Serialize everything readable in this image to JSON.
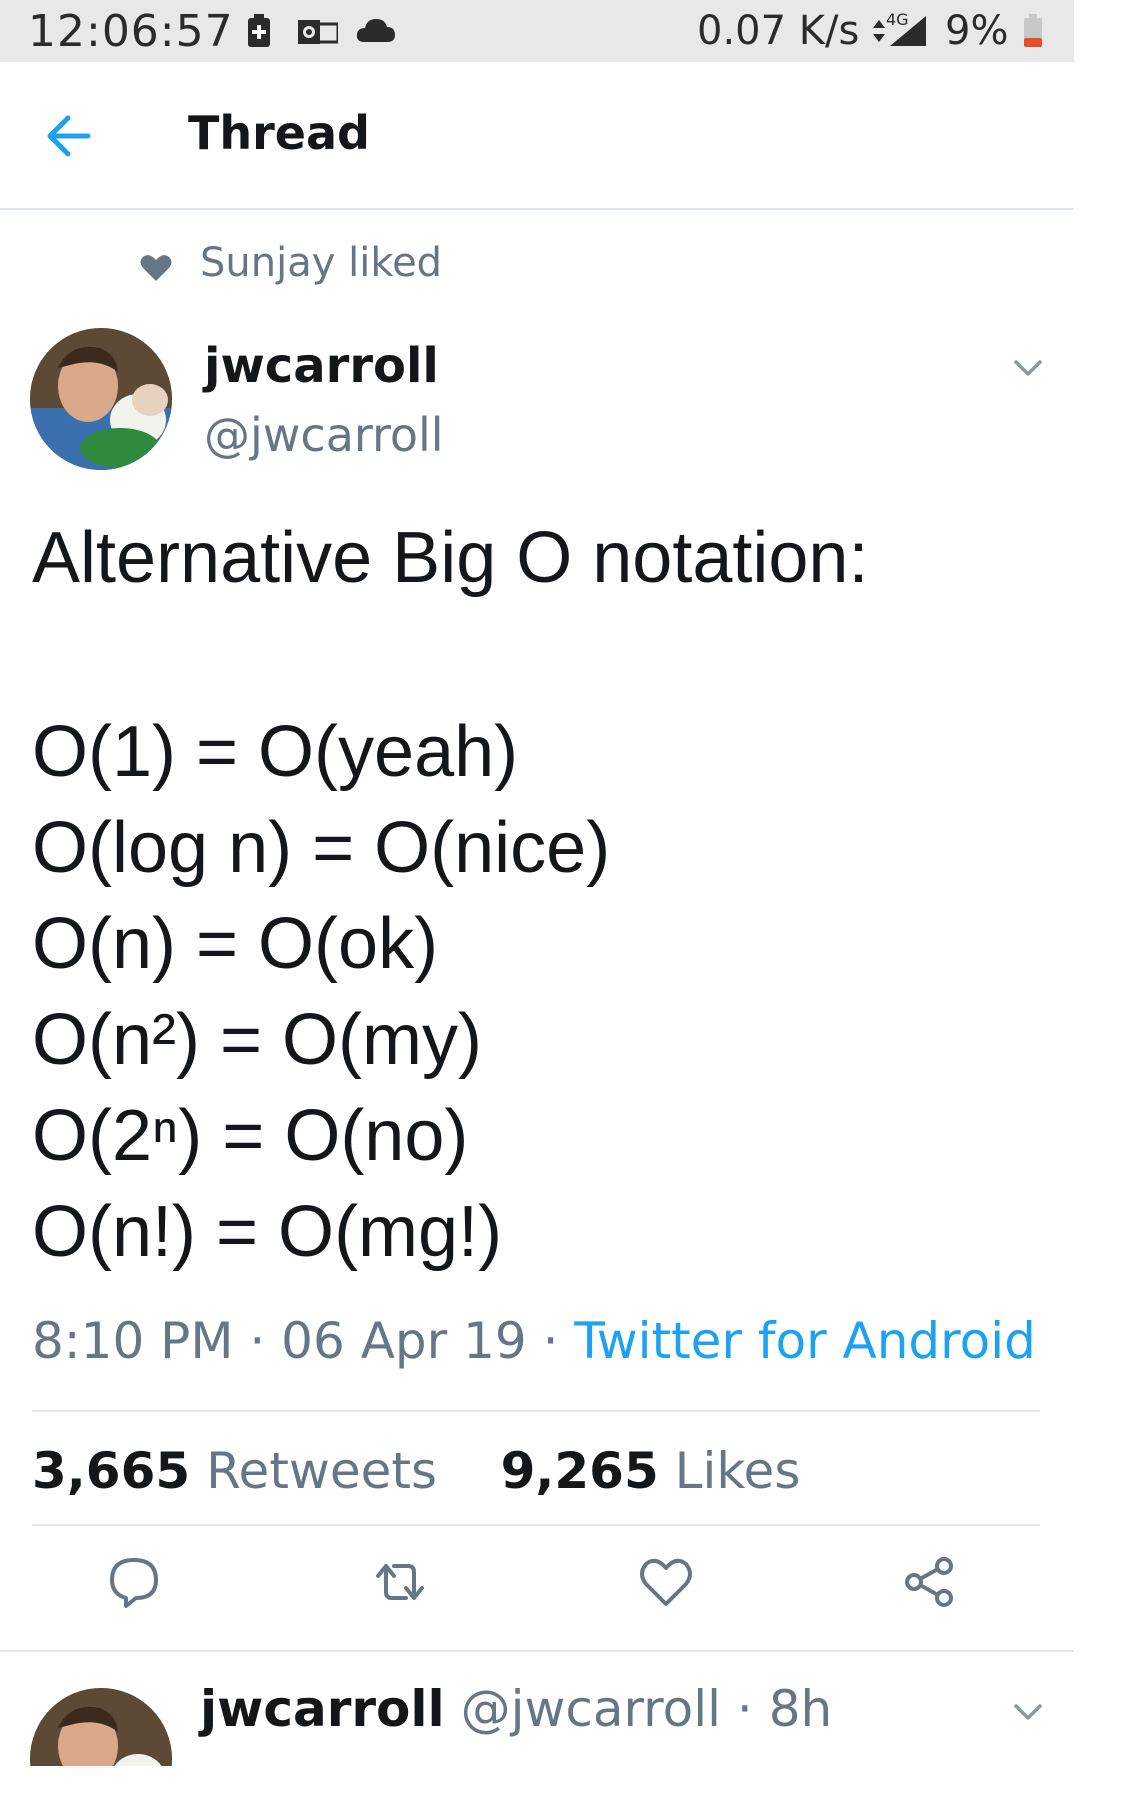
{
  "status_bar": {
    "time": "12:06:57",
    "network_speed": "0.07 K/s",
    "network_type": "4G",
    "battery": "9%"
  },
  "header": {
    "title": "Thread"
  },
  "context": {
    "text": "Sunjay liked"
  },
  "tweet": {
    "author_name": "jwcarroll",
    "author_handle": "@jwcarroll",
    "text_heading": "Alternative Big O notation:",
    "lines": [
      "O(1) = O(yeah)",
      "O(log n) = O(nice)",
      "O(n) = O(ok)",
      "O(n²) = O(my)",
      "O(2ⁿ) = O(no)",
      "O(n!) = O(mg!)"
    ],
    "time": "8:10 PM",
    "date": "06 Apr 19",
    "source": "Twitter for Android",
    "retweets_count": "3,665",
    "retweets_label": "Retweets",
    "likes_count": "9,265",
    "likes_label": "Likes"
  },
  "next_tweet": {
    "author_name": "jwcarroll",
    "author_handle": "@jwcarroll",
    "age": "· 8h"
  },
  "colors": {
    "accent": "#1da1f2",
    "secondary_text": "#657786",
    "divider": "#e1e8ed"
  }
}
